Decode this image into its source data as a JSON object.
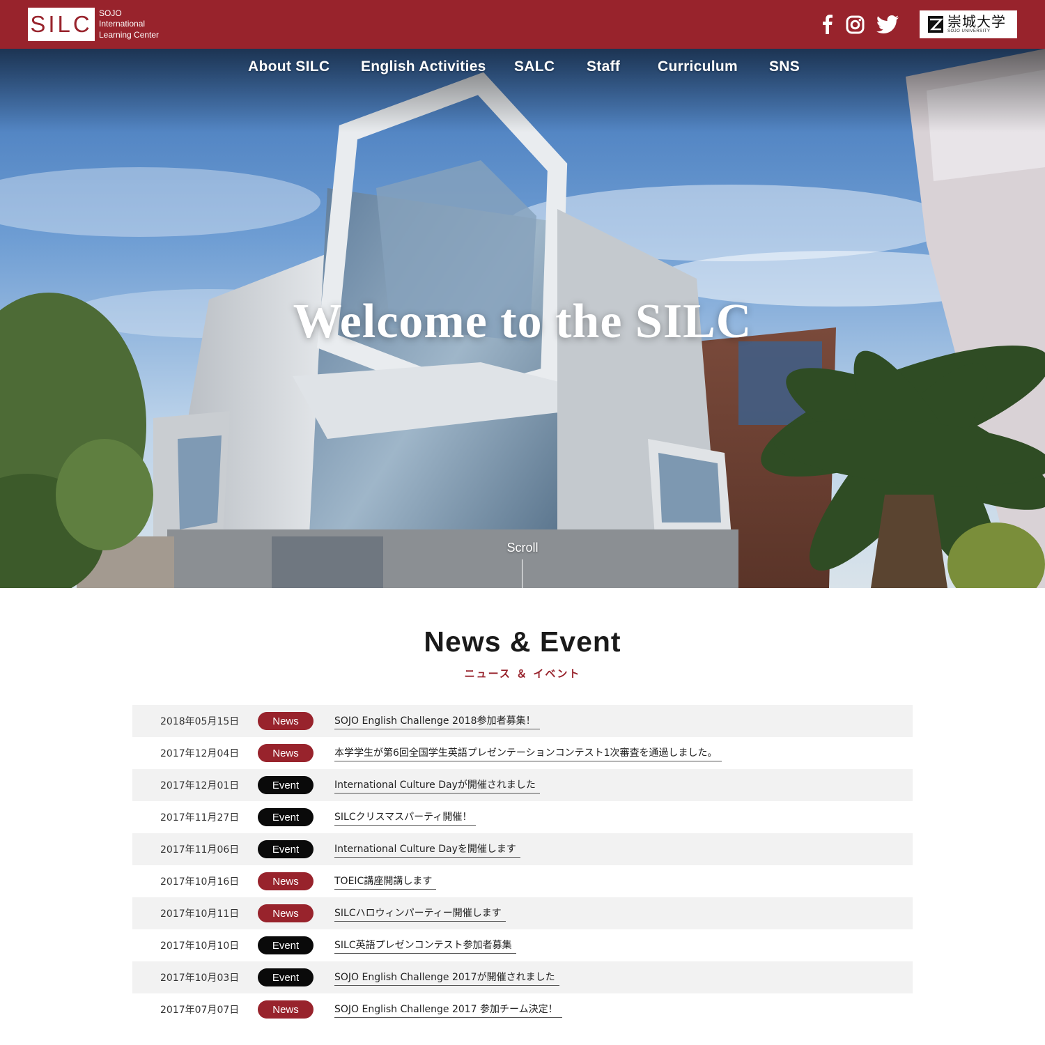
{
  "brand": {
    "logo_mark": "SILC",
    "logo_lines": [
      "SOJO",
      "International",
      "Learning Center"
    ],
    "accent_color": "#98232c",
    "university_jp": "崇城大学",
    "university_en": "SOJO UNIVERSITY"
  },
  "social": [
    {
      "icon": "facebook-icon"
    },
    {
      "icon": "instagram-icon"
    },
    {
      "icon": "twitter-icon"
    }
  ],
  "nav": [
    "About SILC",
    "English Activities",
    "SALC",
    "Staff",
    "Curriculum",
    "SNS"
  ],
  "hero": {
    "title": "Welcome to the SILC",
    "scroll_label": "Scroll"
  },
  "news": {
    "title": "News & Event",
    "subtitle": "ニュース ＆ イベント",
    "items": [
      {
        "date": "2018年05月15日",
        "type": "News",
        "title": "SOJO English Challenge 2018参加者募集！"
      },
      {
        "date": "2017年12月04日",
        "type": "News",
        "title": "本学学生が第6回全国学生英語プレゼンテーションコンテスト1次審査を通過しました。"
      },
      {
        "date": "2017年12月01日",
        "type": "Event",
        "title": "International Culture Dayが開催されました"
      },
      {
        "date": "2017年11月27日",
        "type": "Event",
        "title": "SILCクリスマスパーティ開催！"
      },
      {
        "date": "2017年11月06日",
        "type": "Event",
        "title": "International Culture Dayを開催します"
      },
      {
        "date": "2017年10月16日",
        "type": "News",
        "title": "TOEIC講座開講します"
      },
      {
        "date": "2017年10月11日",
        "type": "News",
        "title": "SILCハロウィンパーティー開催します"
      },
      {
        "date": "2017年10月10日",
        "type": "Event",
        "title": "SILC英語プレゼンコンテスト参加者募集"
      },
      {
        "date": "2017年10月03日",
        "type": "Event",
        "title": "SOJO English Challenge 2017が開催されました"
      },
      {
        "date": "2017年07月07日",
        "type": "News",
        "title": "SOJO English Challenge 2017 参加チーム決定！"
      }
    ]
  }
}
